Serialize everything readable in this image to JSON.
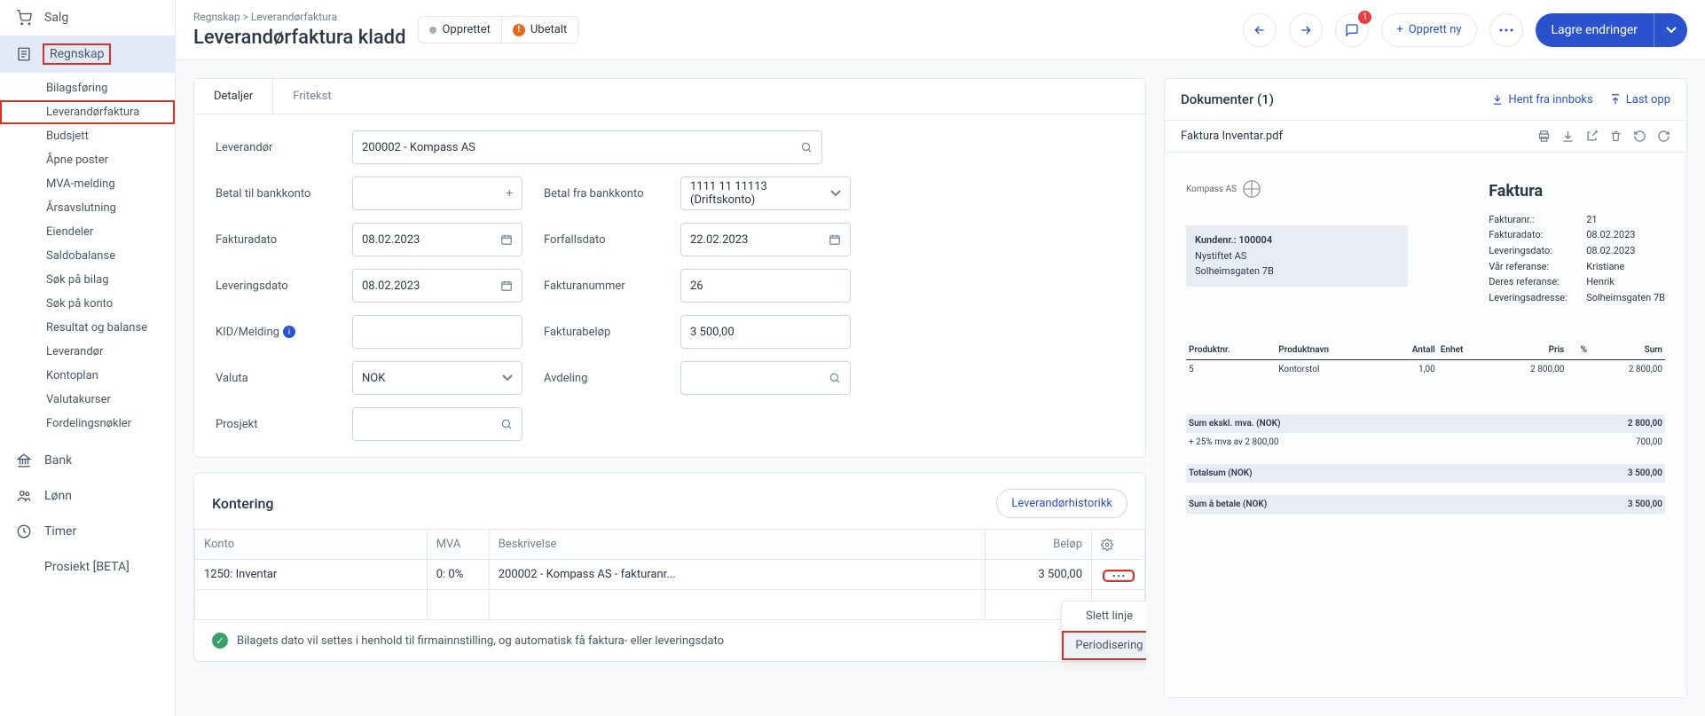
{
  "sidebar": {
    "main": [
      {
        "label": "Salg",
        "icon": "cart"
      },
      {
        "label": "Regnskap",
        "icon": "doc",
        "active": true,
        "hl": true
      },
      {
        "label": "Bank",
        "icon": "bank"
      },
      {
        "label": "Lønn",
        "icon": "people"
      },
      {
        "label": "Timer",
        "icon": "clock"
      },
      {
        "label": "Prosiekt [BETA]",
        "icon": "folder"
      }
    ],
    "regnskap_sub": [
      {
        "label": "Bilagsføring"
      },
      {
        "label": "Leverandørfaktura",
        "hl": true
      },
      {
        "label": "Budsjett"
      },
      {
        "label": "Åpne poster"
      },
      {
        "label": "MVA-melding"
      },
      {
        "label": "Årsavslutning"
      },
      {
        "label": "Eiendeler"
      },
      {
        "label": "Saldobalanse"
      },
      {
        "label": "Søk på bilag"
      },
      {
        "label": "Søk på konto"
      },
      {
        "label": "Resultat og balanse"
      },
      {
        "label": "Leverandør"
      },
      {
        "label": "Kontoplan"
      },
      {
        "label": "Valutakurser"
      },
      {
        "label": "Fordelingsnøkler"
      }
    ]
  },
  "header": {
    "breadcrumb": "Regnskap > Leverandørfaktura",
    "title": "Leverandørfaktura kladd",
    "chip_created": "Opprettet",
    "chip_unpaid": "Ubetalt",
    "create": "Opprett ny",
    "save": "Lagre endringer",
    "msg_count": "1"
  },
  "tabs": {
    "details": "Detaljer",
    "freetext": "Fritekst"
  },
  "form": {
    "supplier_label": "Leverandør",
    "supplier_value": "200002 - Kompass AS",
    "pay_to_label": "Betal til bankkonto",
    "pay_from_label": "Betal fra bankkonto",
    "pay_from_value": "1111 11 11113 (Driftskonto)",
    "invoice_date_label": "Fakturadato",
    "invoice_date_value": "08.02.2023",
    "due_date_label": "Forfallsdato",
    "due_date_value": "22.02.2023",
    "delivery_date_label": "Leveringsdato",
    "delivery_date_value": "08.02.2023",
    "invoice_no_label": "Fakturanummer",
    "invoice_no_value": "26",
    "kid_label": "KID/Melding",
    "amount_label": "Fakturabeløp",
    "amount_value": "3 500,00",
    "currency_label": "Valuta",
    "currency_value": "NOK",
    "department_label": "Avdeling",
    "project_label": "Prosjekt"
  },
  "kontering": {
    "title": "Kontering",
    "history_btn": "Leverandørhistorikk",
    "cols": {
      "konto": "Konto",
      "mva": "MVA",
      "beskrivelse": "Beskrivelse",
      "belop": "Beløp"
    },
    "row": {
      "konto": "1250: Inventar",
      "mva": "0: 0%",
      "beskrivelse": "200002 - Kompass AS - fakturanr...",
      "belop": "3 500,00"
    },
    "menu": {
      "delete": "Slett linje",
      "periodisering": "Periodisering"
    },
    "status": "Bilagets dato vil settes i henhold til firmainnstilling, og automatisk få faktura- eller leveringsdato"
  },
  "documents": {
    "title": "Dokumenter (1)",
    "fetch": "Hent fra innboks",
    "upload": "Last opp",
    "filename": "Faktura Inventar.pdf"
  },
  "preview": {
    "logo_text": "Kompass AS",
    "faktura": "Faktura",
    "meta": [
      {
        "k": "Fakturanr.:",
        "v": "21"
      },
      {
        "k": "Fakturadato:",
        "v": "08.02.2023"
      },
      {
        "k": "Leveringsdato:",
        "v": "08.02.2023"
      },
      {
        "k": "Vår referanse:",
        "v": "Kristiane"
      },
      {
        "k": "Deres referanse:",
        "v": "Henrik"
      },
      {
        "k": "Leveringsadresse:",
        "v": "Solheimsgaten 7B"
      }
    ],
    "cust": [
      "Kundenr.: 100004",
      "Nystiftet AS",
      "Solheimsgaten 7B"
    ],
    "cols": [
      "Produktnr.",
      "Produktnavn",
      "Antall",
      "Enhet",
      "Pris",
      "%",
      "Sum"
    ],
    "rows": [
      [
        "5",
        "Kontorstol",
        "1,00",
        "",
        "2 800,00",
        "",
        "2 800,00"
      ]
    ],
    "totals": [
      {
        "label": "Sum ekskl. mva. (NOK)",
        "value": "2 800,00",
        "bg": true,
        "bold": true
      },
      {
        "label": "+ 25% mva av 2 800,00",
        "value": "700,00"
      },
      {
        "label": "Totalsum (NOK)",
        "value": "3 500,00",
        "bg": true,
        "bold": true
      },
      {
        "label": "Sum å betale (NOK)",
        "value": "3 500,00",
        "bg": true,
        "bold": true
      }
    ]
  }
}
